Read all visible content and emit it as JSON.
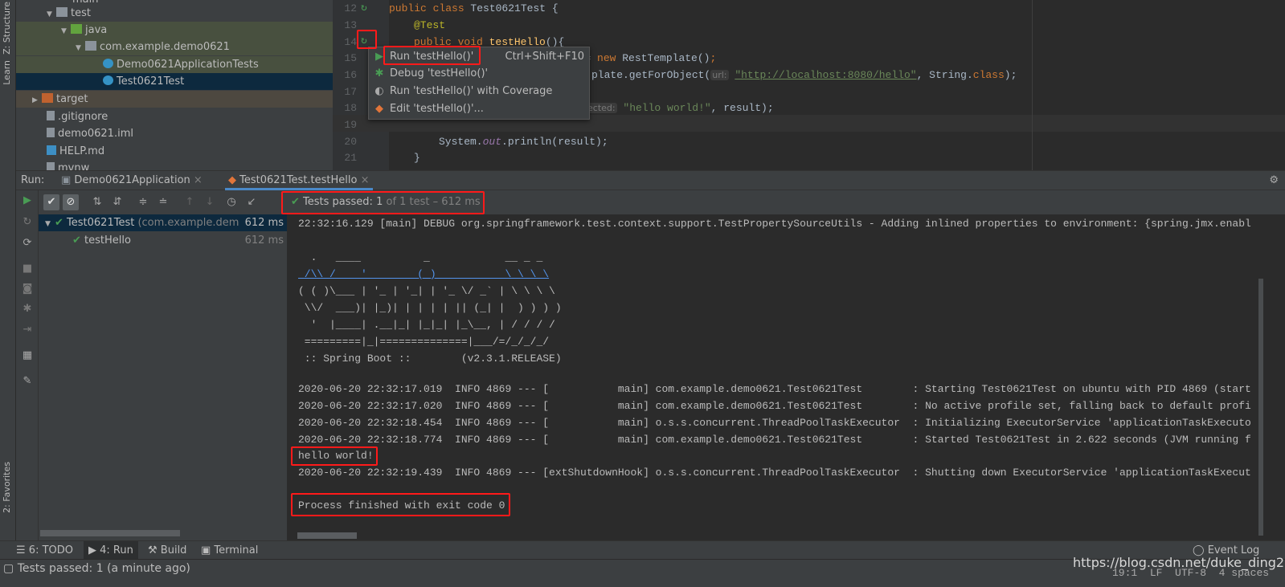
{
  "side_strip": {
    "structure": "Z: Structure",
    "learn": "Learn",
    "favorites": "2: Favorites"
  },
  "project_tree": [
    {
      "label": "main",
      "type": "folder"
    },
    {
      "label": "test",
      "type": "folder"
    },
    {
      "label": "java",
      "type": "test-source-folder"
    },
    {
      "label": "com.example.demo0621",
      "type": "package"
    },
    {
      "label": "Demo0621ApplicationTests",
      "type": "test-class"
    },
    {
      "label": "Test0621Test",
      "type": "test-class",
      "selected": true
    },
    {
      "label": "target",
      "type": "excluded-folder"
    },
    {
      "label": ".gitignore",
      "type": "file"
    },
    {
      "label": "demo0621.iml",
      "type": "file"
    },
    {
      "label": "HELP.md",
      "type": "markdown-file"
    },
    {
      "label": "mvnw",
      "type": "file"
    }
  ],
  "editor": {
    "line_numbers": [
      "12",
      "13",
      "14",
      "15",
      "16",
      "17",
      "18",
      "19",
      "20",
      "21"
    ],
    "lines": {
      "l12a": "public class ",
      "l12b": "Test0621Test {",
      "l13": "@Test",
      "l14a": "public void ",
      "l14b": "testHello",
      "l14c": "(){",
      "l15a": "te = ",
      "l15b": "new ",
      "l15c": "RestTemplate()",
      "l15d": ";",
      "l16a": "plate.getForObject(",
      "l16hint": "url:",
      "l16b": "\"http://localhost:8080/hello\"",
      "l16c": ", String.",
      "l16d": "class",
      "l16e": ");",
      "l18hint": "ected:",
      "l18a": "\"hello world!\"",
      "l18b": ", result);",
      "l20a": "System.",
      "l20b": "out",
      "l20c": ".println(result);",
      "l21": "}"
    }
  },
  "context_menu": {
    "items": [
      {
        "label": "Run 'testHello()'",
        "shortcut": "Ctrl+Shift+F10",
        "icon": "run-icon"
      },
      {
        "label": "Debug 'testHello()'",
        "icon": "debug-icon"
      },
      {
        "label": "Run 'testHello()' with Coverage",
        "icon": "coverage-icon"
      },
      {
        "label": "Edit 'testHello()'...",
        "icon": "edit-config-icon"
      }
    ]
  },
  "run_panel": {
    "label": "Run:",
    "tabs": [
      {
        "label": "Demo0621Application",
        "active": false
      },
      {
        "label": "Test0621Test.testHello",
        "active": true
      }
    ],
    "status": {
      "prefix": "Tests passed: ",
      "count": "1",
      "suffix": " of 1 test – 612 ms"
    },
    "tree": [
      {
        "name": "Test0621Test",
        "detail": " (com.example.dem",
        "time": "612 ms"
      },
      {
        "name": "testHello",
        "time": "612 ms"
      }
    ]
  },
  "console": [
    "22:32:16.129 [main] DEBUG org.springframework.test.context.support.TestPropertySourceUtils - Adding inlined properties to environment: {spring.jmx.enabl",
    "",
    "",
    "  .   ____          _            __ _ _",
    " /\\\\ / ___'_ __ _ _(_)_ __  __ _ \\ \\ \\ \\",
    "( ( )\\___ | '_ | '_| | '_ \\/ _` | \\ \\ \\ \\",
    " \\\\/  ___)| |_)| | | | | || (_| |  ) ) ) )",
    "  '  |____| .__|_| |_|_| |_\\__, | / / / /",
    " =========|_|==============|___/=/_/_/_/",
    " :: Spring Boot ::        (v2.3.1.RELEASE)",
    "",
    "2020-06-20 22:32:17.019  INFO 4869 --- [           main] com.example.demo0621.Test0621Test        : Starting Test0621Test on ubuntu with PID 4869 (start",
    "2020-06-20 22:32:17.020  INFO 4869 --- [           main] com.example.demo0621.Test0621Test        : No active profile set, falling back to default profi",
    "2020-06-20 22:32:18.454  INFO 4869 --- [           main] o.s.s.concurrent.ThreadPoolTaskExecutor  : Initializing ExecutorService 'applicationTaskExecuto",
    "2020-06-20 22:32:18.774  INFO 4869 --- [           main] com.example.demo0621.Test0621Test        : Started Test0621Test in 2.622 seconds (JVM running f",
    "hello world!",
    "2020-06-20 22:32:19.439  INFO 4869 --- [extShutdownHook] o.s.s.concurrent.ThreadPoolTaskExecutor  : Shutting down ExecutorService 'applicationTaskExecut",
    "",
    "Process finished with exit code 0"
  ],
  "bottom_tabs": [
    {
      "label": "6: TODO",
      "icon": "todo-list-icon"
    },
    {
      "label": "4: Run",
      "icon": "run-icon",
      "active": true
    },
    {
      "label": "Build",
      "icon": "hammer-icon"
    },
    {
      "label": "Terminal",
      "icon": "terminal-icon"
    }
  ],
  "event_log": "Event Log",
  "status_bar": {
    "message": "Tests passed: 1 (a minute ago)",
    "position": "19:1",
    "line_ending": "LF",
    "encoding": "UTF-8",
    "indent": "4 spaces",
    "watermark": "https://blog.csdn.net/duke_ding2"
  },
  "colors": {
    "accent_green": "#499c54",
    "highlight_red": "#ff1a1a",
    "selection": "#0d293e"
  }
}
